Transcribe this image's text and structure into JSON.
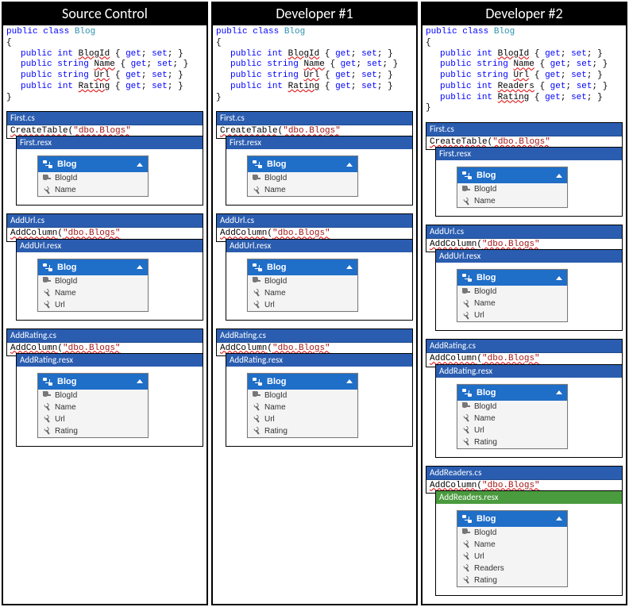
{
  "columns": [
    {
      "title": "Source Control",
      "code": {
        "class_kw": "public class",
        "class_name": "Blog",
        "props": [
          {
            "mods": "public",
            "type": "int",
            "name": "BlogId",
            "acc": "{ get; set; }"
          },
          {
            "mods": "public",
            "type": "string",
            "name": "Name",
            "acc": "{ get; set; }"
          },
          {
            "mods": "public",
            "type": "string",
            "name": "Url",
            "acc": "{ get; set; }"
          },
          {
            "mods": "public",
            "type": "int",
            "name": "Rating",
            "acc": "{ get; set; }"
          }
        ]
      },
      "migrations": [
        {
          "cs": "First.cs",
          "call": "CreateTable",
          "arg": "\"dbo.Blogs\"",
          "resx": "First.resx",
          "entity_props": [
            "BlogId",
            "Name"
          ]
        },
        {
          "cs": "AddUrl.cs",
          "call": "AddColumn",
          "arg": "\"dbo.Blogs\"",
          "resx": "AddUrl.resx",
          "entity_props": [
            "BlogId",
            "Name",
            "Url"
          ]
        },
        {
          "cs": "AddRating.cs",
          "call": "AddColumn",
          "arg": "\"dbo.Blogs\"",
          "resx": "AddRating.resx",
          "entity_props": [
            "BlogId",
            "Name",
            "Url",
            "Rating"
          ]
        }
      ]
    },
    {
      "title": "Developer #1",
      "code": {
        "class_kw": "public class",
        "class_name": "Blog",
        "props": [
          {
            "mods": "public",
            "type": "int",
            "name": "BlogId",
            "acc": "{ get; set; }"
          },
          {
            "mods": "public",
            "type": "string",
            "name": "Name",
            "acc": "{ get; set; }"
          },
          {
            "mods": "public",
            "type": "string",
            "name": "Url",
            "acc": "{ get; set; }"
          },
          {
            "mods": "public",
            "type": "int",
            "name": "Rating",
            "acc": "{ get; set; }"
          }
        ]
      },
      "migrations": [
        {
          "cs": "First.cs",
          "call": "CreateTable",
          "arg": "\"dbo.Blogs\"",
          "resx": "First.resx",
          "entity_props": [
            "BlogId",
            "Name"
          ]
        },
        {
          "cs": "AddUrl.cs",
          "call": "AddColumn",
          "arg": "\"dbo.Blogs\"",
          "resx": "AddUrl.resx",
          "entity_props": [
            "BlogId",
            "Name",
            "Url"
          ]
        },
        {
          "cs": "AddRating.cs",
          "call": "AddColumn",
          "arg": "\"dbo.Blogs\"",
          "resx": "AddRating.resx",
          "entity_props": [
            "BlogId",
            "Name",
            "Url",
            "Rating"
          ]
        }
      ]
    },
    {
      "title": "Developer #2",
      "code": {
        "class_kw": "public class",
        "class_name": "Blog",
        "props": [
          {
            "mods": "public",
            "type": "int",
            "name": "BlogId",
            "acc": "{ get; set; }"
          },
          {
            "mods": "public",
            "type": "string",
            "name": "Name",
            "acc": "{ get; set; }"
          },
          {
            "mods": "public",
            "type": "string",
            "name": "Url",
            "acc": "{ get; set; }"
          },
          {
            "mods": "public",
            "type": "int",
            "name": "Readers",
            "acc": "{ get; set; }"
          },
          {
            "mods": "public",
            "type": "int",
            "name": "Rating",
            "acc": "{ get; set; }"
          }
        ]
      },
      "migrations": [
        {
          "cs": "First.cs",
          "call": "CreateTable",
          "arg": "\"dbo.Blogs\"",
          "resx": "First.resx",
          "entity_props": [
            "BlogId",
            "Name"
          ]
        },
        {
          "cs": "AddUrl.cs",
          "call": "AddColumn",
          "arg": "\"dbo.Blogs\"",
          "resx": "AddUrl.resx",
          "entity_props": [
            "BlogId",
            "Name",
            "Url"
          ]
        },
        {
          "cs": "AddRating.cs",
          "call": "AddColumn",
          "arg": "\"dbo.Blogs\"",
          "resx": "AddRating.resx",
          "entity_props": [
            "BlogId",
            "Name",
            "Url",
            "Rating"
          ]
        },
        {
          "cs": "AddReaders.cs",
          "call": "AddColumn",
          "arg": "\"dbo.Blogs\"",
          "resx": "AddReaders.resx",
          "resx_green": true,
          "entity_props": [
            "BlogId",
            "Name",
            "Url",
            "Readers",
            "Rating"
          ]
        }
      ]
    }
  ],
  "entity_name": "Blog"
}
